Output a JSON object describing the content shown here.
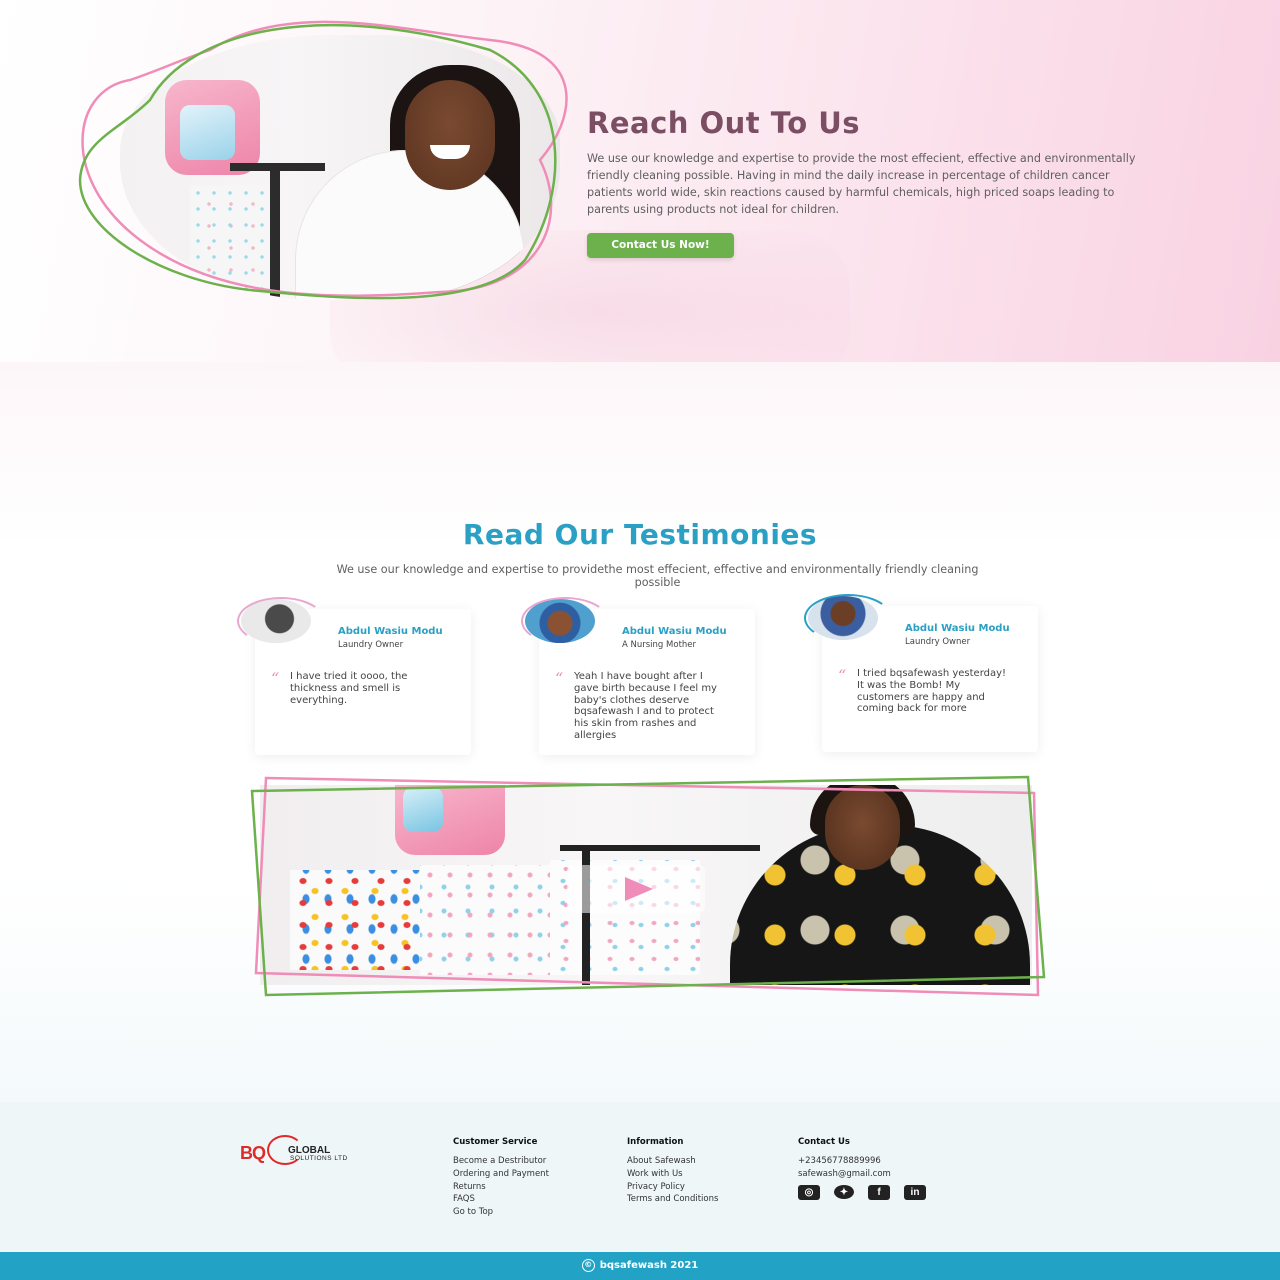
{
  "hero": {
    "title": "Reach Out To Us",
    "text": "We use our knowledge and expertise to provide the most effecient, effective and environmentally friendly cleaning possible. Having in mind the daily increase in percentage of children cancer patients world wide, skin reactions caused by harmful chemicals, high priced soaps leading to parents using products not ideal for children.",
    "button_label": "Contact Us Now!"
  },
  "testimonies": {
    "title": "Read Our Testimonies",
    "subtitle": "We use our knowledge and expertise to providethe most effecient, effective and environmentally friendly cleaning possible",
    "cards": [
      {
        "name": "Abdul Wasiu Modu",
        "role": "Laundry Owner",
        "quote": "I have tried it oooo, the thickness and smell is everything."
      },
      {
        "name": "Abdul Wasiu Modu",
        "role": "A Nursing Mother",
        "quote": "Yeah I have bought after I gave birth because I feel my baby's clothes deserve bqsafewash I and to protect his skin from rashes and allergies"
      },
      {
        "name": "Abdul Wasiu Modu",
        "role": "Laundry Owner",
        "quote": "I tried bqsafewash yesterday! It was the Bomb! My customers are happy and coming back for more"
      }
    ],
    "quote_mark": "“"
  },
  "footer": {
    "logo": {
      "bq": "BQ",
      "global": "GLOBAL",
      "solutions": "SOLUTIONS LTD"
    },
    "customer_service": {
      "heading": "Customer Service",
      "links": [
        "Become a Destributor",
        "Ordering and Payment",
        "Returns",
        "FAQS",
        "Go to Top"
      ]
    },
    "information": {
      "heading": "Information",
      "links": [
        "About Safewash",
        "Work with Us",
        "Privacy Policy",
        "Terms and Conditions"
      ]
    },
    "contact": {
      "heading": "Contact Us",
      "phone": "+23456778889996",
      "email": "safewash@gmail.com"
    },
    "socials": [
      "instagram-icon",
      "twitter-icon",
      "facebook-icon",
      "linkedin-icon"
    ],
    "copyright_symbol": "©",
    "copyright": "bqsafewash 2021"
  },
  "colors": {
    "accent_green": "#6cb14c",
    "accent_pink": "#f08cb8",
    "accent_blue": "#2aa0c4",
    "title_plum": "#7b4e64",
    "footer_bar": "#22a3c6"
  }
}
